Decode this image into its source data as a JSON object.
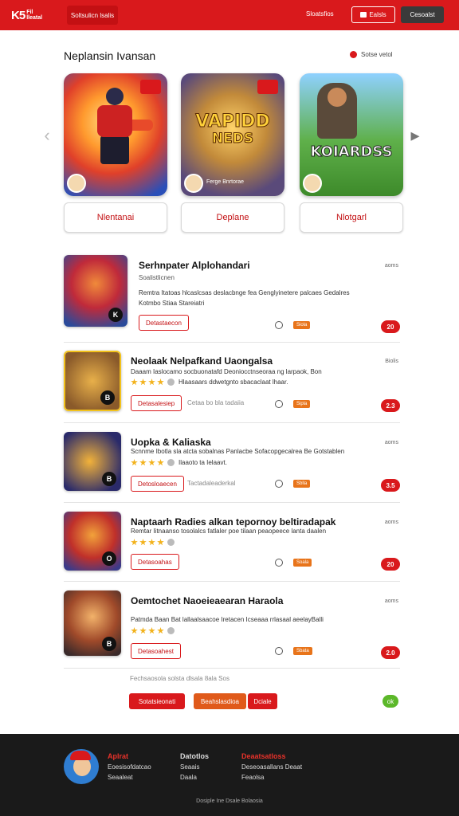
{
  "header": {
    "logo_mark": "K5",
    "logo_text_1": "Fil",
    "logo_text_2": "lleatal",
    "nav_tab": "Soltsulicn lsalis",
    "nav_link": "Sloatsfios",
    "login_label": "Ealsls",
    "signup_label": "Cesoalst"
  },
  "featured": {
    "title": "Neplansin Ivansan",
    "more_label": "Sotse vetol",
    "cards": [
      {
        "title": "",
        "subtitle": "",
        "button": "Nlentanai"
      },
      {
        "title": "VAPIDD",
        "title2": "NEDS",
        "subtitle": "Ferge Bnrtorae",
        "button": "Deplane"
      },
      {
        "title": "KOIARDSS",
        "subtitle": "",
        "button": "Nlotgarl"
      }
    ]
  },
  "list": [
    {
      "name": "Serhnpater Alplohandari",
      "time": "aoms",
      "meta": "Soalistlicnen",
      "desc": "Remtra Itatoas hlcaslcsas deslacbnge fea Genglyinetere palcaes Gedalres",
      "rating_label": "Kotmbo Stiaa Stareiatri",
      "button": "Detastaecon",
      "gray_link": "",
      "tag": "Siola",
      "score": "20",
      "icon_num": "K"
    },
    {
      "name": "Neolaak Nelpafkand Uaongalsa",
      "time": "Biolis",
      "meta": "",
      "desc": "Daaam Iaslocamo socbuonatafd Deoniocctnseoraa ng larpaok, Bon",
      "rating_label": "Hlaasaars ddwetgnto sbacaclaat lhaar.",
      "button": "Detasalesiep",
      "gray_link": "Cetaa bo bla tadaiia",
      "tag": "Sipla",
      "score": "2.3",
      "icon_num": "B"
    },
    {
      "name": "Uopka & Kaliaska",
      "time": "aoms",
      "meta": "",
      "desc": "Scnnme Ibotla sla atcta sobalnas Panlacbe Sofacopgecalrea Be Gotstablen",
      "rating_label": "Ilaaoto ta Ielaavt.",
      "button": "Detosloaecen",
      "gray_link": "Tactadaleaderkal",
      "tag": "Sblla",
      "score": "3.5",
      "icon_num": "B"
    },
    {
      "name": "Naptaarh Radies alkan tepornoy beltiradapak",
      "time": "aoms",
      "meta": "",
      "desc": "Remtar Iitnaanso tosolalcs fatlaler poe tilaan peaopeece lanta daalen",
      "rating_label": "",
      "button": "Detasoahas",
      "gray_link": "",
      "tag": "Soala",
      "score": "20",
      "icon_num": "O"
    },
    {
      "name": "Oemtochet Naoeieaearan Haraola",
      "time": "aoms",
      "meta": "",
      "desc": "Patmda Baan Bat lallaalsaacoe Iretacen Icseaaa rrlasaal aeelayBalli",
      "rating_label": "",
      "button": "Detasoahest",
      "gray_link": "",
      "tag": "Sbata",
      "score": "2.0",
      "icon_num": "B"
    }
  ],
  "pagination": {
    "note": "Fechsaosola solsta dlsala 8ala Sos",
    "btn1": "Sotatsieonati",
    "btn2": "Beahslasdioa",
    "btn3": "Dciale",
    "ok": "ok"
  },
  "footer": {
    "col1_title": "Aplrat",
    "col1_line1": "Eoesisofdatcao",
    "col1_line2": "Seaaleat",
    "col2_title": "Datotlos",
    "col2_line1": "Seaais",
    "col2_line2": "Daala",
    "col3_title": "Deaatsatloss",
    "col3_line1": "Deseoasallans Deaat",
    "col3_line2": "Feaolsa",
    "copyright": "Dosiple Ine  Dsale Bolaosia"
  },
  "colors": {
    "brand": "#d9191c",
    "footer": "#1a1a1a",
    "accent_orange": "#e8741a",
    "ok_green": "#5cb82a"
  }
}
